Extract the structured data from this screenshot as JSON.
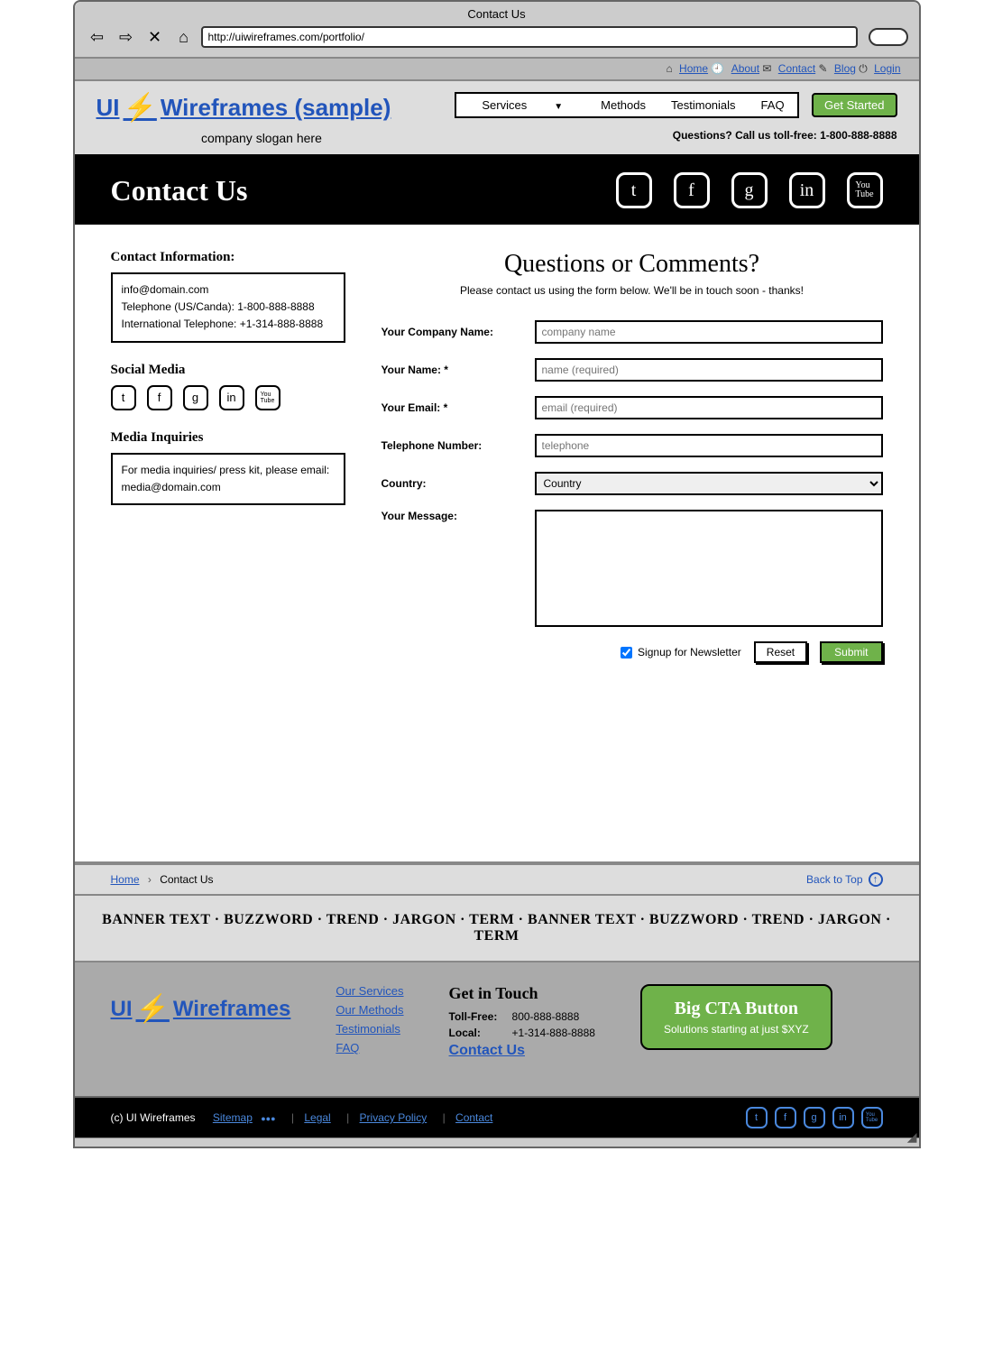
{
  "browser": {
    "title": "Contact Us",
    "url": "http://uiwireframes.com/portfolio/"
  },
  "topnav": {
    "home": "Home",
    "about": "About",
    "contact": "Contact",
    "blog": "Blog",
    "login": "Login"
  },
  "header": {
    "logo": "UI",
    "logo2": "Wireframes (sample)",
    "slogan": "company slogan here",
    "nav": {
      "services": "Services",
      "methods": "Methods",
      "testimonials": "Testimonials",
      "faq": "FAQ"
    },
    "cta": "Get Started",
    "tollfree": "Questions? Call us toll-free: 1-800-888-8888"
  },
  "hero": {
    "title": "Contact Us"
  },
  "sidebar": {
    "contact_h": "Contact Information:",
    "email": "info@domain.com",
    "tel_us": "Telephone (US/Canda): 1-800-888-8888",
    "tel_intl": "International Telephone: +1-314-888-8888",
    "social_h": "Social Media",
    "media_h": "Media Inquiries",
    "media_line1": "For media inquiries/ press kit, please email:",
    "media_line2": "media@domain.com"
  },
  "form": {
    "title": "Questions or Comments?",
    "sub": "Please contact us using the form below. We'll be in touch soon - thanks!",
    "company_l": "Your Company Name:",
    "company_ph": "company name",
    "name_l": "Your Name: *",
    "name_ph": "name (required)",
    "email_l": "Your Email: *",
    "email_ph": "email (required)",
    "tel_l": "Telephone Number:",
    "tel_ph": "telephone",
    "country_l": "Country:",
    "country_opt": "Country",
    "msg_l": "Your Message:",
    "newsletter": "Signup for Newsletter",
    "reset": "Reset",
    "submit": "Submit"
  },
  "breadcrumb": {
    "home": "Home",
    "current": "Contact Us",
    "backtop": "Back to Top"
  },
  "banner": "BANNER TEXT · BUZZWORD · TREND · JARGON · TERM · BANNER TEXT · BUZZWORD · TREND · JARGON · TERM",
  "footer": {
    "logo1": "UI",
    "logo2": "Wireframes",
    "links": {
      "services": "Our Services",
      "methods": "Our Methods",
      "testimonials": "Testimonials",
      "faq": "FAQ"
    },
    "git_h": "Get in Touch",
    "tollfree_l": "Toll-Free:",
    "tollfree_v": "800-888-8888",
    "local_l": "Local:",
    "local_v": "+1-314-888-8888",
    "contact_link": "Contact Us",
    "cta_t1": "Big CTA Button",
    "cta_t2": "Solutions starting at just $XYZ"
  },
  "footbar": {
    "copyright": "(c) UI Wireframes",
    "sitemap": "Sitemap",
    "dots": "●●●",
    "legal": "Legal",
    "privacy": "Privacy Policy",
    "contact": "Contact"
  }
}
